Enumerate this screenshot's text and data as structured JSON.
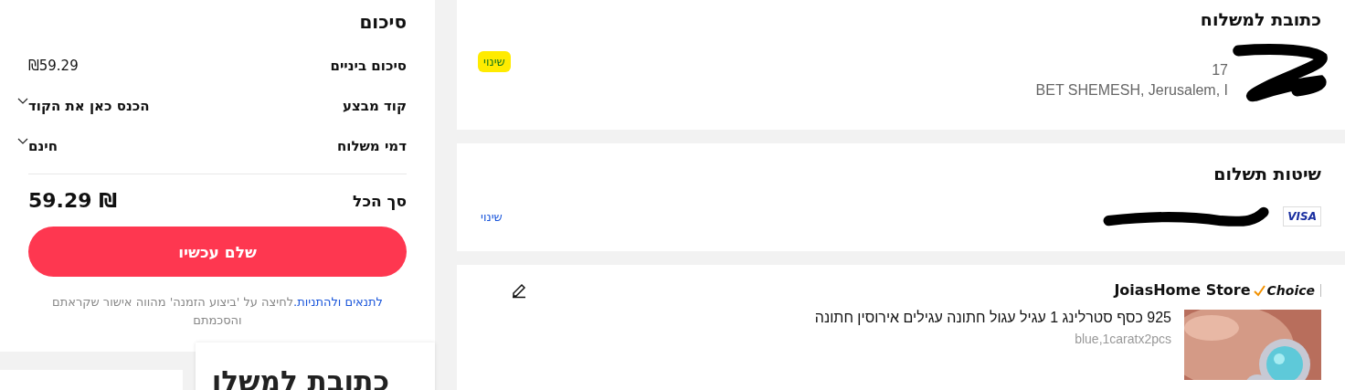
{
  "summary": {
    "title": "סיכום",
    "rows": [
      {
        "label": "סיכום ביניים",
        "value": "₪59.29",
        "kind": "plain"
      },
      {
        "label": "קוד מבצע",
        "value": "הכנס כאן את הקוד",
        "kind": "dropdown"
      },
      {
        "label": "דמי משלוח",
        "value": "חינם",
        "kind": "dropdown"
      }
    ],
    "total_label": "סך הכל",
    "total_value": "₪ 59.29",
    "pay_button": "שלם עכשיו",
    "terms_link": "לתנאים ולהתניות.",
    "terms_text": "לחיצה על 'ביצוע הזמנה' מהווה אישור שקראתם והסכמתם"
  },
  "overlay_heading": "כתובת למשלו",
  "shipping": {
    "title": "כתובת למשלוח",
    "change": "שינוי",
    "address_lines": [
      "17",
      "BET SHEMESH, Jerusalem, I"
    ]
  },
  "payment": {
    "title": "שיטות תשלום",
    "card_brand": "VISA",
    "change": "שינוי"
  },
  "store": {
    "name": "JoiasHome Store",
    "badge": "Choice",
    "items": [
      {
        "title": "925 כסף סטרלינג 1 עגיל עגול חתונה עגילים אירוסין חתונה",
        "variant": "blue,1caratx2pcs",
        "kind": "picture"
      }
    ]
  }
}
